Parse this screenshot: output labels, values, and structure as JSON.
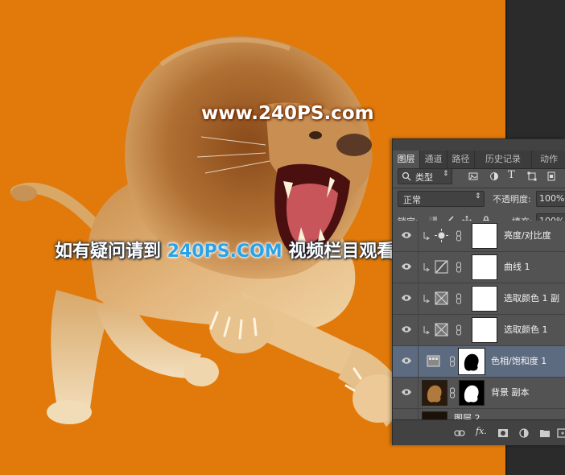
{
  "watermark": {
    "url": "www.240PS.com",
    "line_prefix": "如有疑问请到 ",
    "line_brand": "240PS.COM",
    "line_suffix": " 视频栏目观看视频教程"
  },
  "panel": {
    "tabs": [
      {
        "label": "图层",
        "active": true
      },
      {
        "label": "通道",
        "active": false
      },
      {
        "label": "路径",
        "active": false
      },
      {
        "label": "历史记录",
        "active": false
      },
      {
        "label": "动作",
        "active": false
      }
    ],
    "filter_label": "类型",
    "blend_mode": "正常",
    "opacity_label": "不透明度:",
    "opacity_value": "100%",
    "lock_label": "锁定:",
    "fill_label": "填充:",
    "fill_value": "100%",
    "layers": [
      {
        "name": "亮度/对比度",
        "type": "adjustment",
        "clipped": true,
        "selected": false
      },
      {
        "name": "曲线 1",
        "type": "adjustment",
        "clipped": true,
        "selected": false
      },
      {
        "name": "选取颜色 1 副",
        "type": "adjustment",
        "clipped": true,
        "selected": false
      },
      {
        "name": "选取颜色 1",
        "type": "adjustment",
        "clipped": true,
        "selected": false
      },
      {
        "name": "色相/饱和度 1",
        "type": "adjustment",
        "clipped": false,
        "selected": true
      },
      {
        "name": "背景 副本",
        "type": "pixel",
        "clipped": false,
        "selected": false
      },
      {
        "name": "图层 2",
        "type": "pixel",
        "clipped": false,
        "selected": false
      }
    ],
    "footer_fx": "fx."
  },
  "colors": {
    "background": "#e17a0a",
    "panel": "#535353",
    "selected_layer": "#5d6b80",
    "brand_blue": "#29a3e8"
  }
}
